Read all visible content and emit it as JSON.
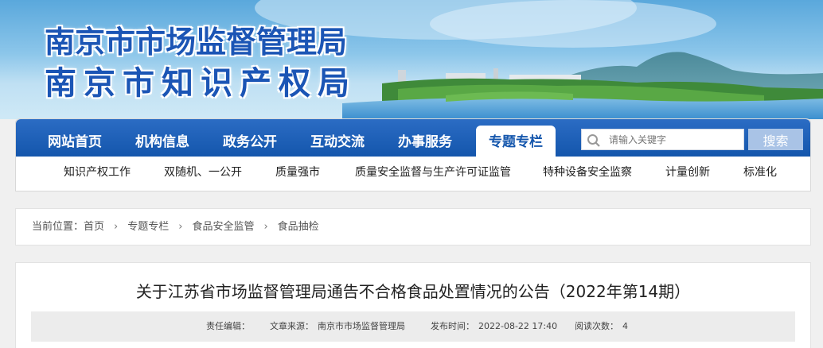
{
  "site": {
    "title_line1": "南京市市场监督管理局",
    "title_line2": "南京市知识产权局"
  },
  "nav": {
    "main_items": [
      "网站首页",
      "机构信息",
      "政务公开",
      "互动交流",
      "办事服务",
      "专题专栏"
    ],
    "active_item": "专题专栏",
    "sub_items": [
      "知识产权工作",
      "双随机、一公开",
      "质量强市",
      "质量安全监督与生产许可证监管",
      "特种设备安全监察",
      "计量创新",
      "标准化"
    ]
  },
  "search": {
    "placeholder": "请输入关键字",
    "button_label": "搜索",
    "icon": "search-icon"
  },
  "breadcrumb": {
    "prefix": "当前位置：",
    "items": [
      "首页",
      "专题专栏",
      "食品安全监管",
      "食品抽检"
    ]
  },
  "article": {
    "title": "关于江苏省市场监督管理局通告不合格食品处置情况的公告（2022年第14期）",
    "editor_label": "责任编辑：",
    "source_label": "文章来源：",
    "source_value": "南京市市场监督管理局",
    "date_label": "发布时间：",
    "date_value": "2022-08-22 17:40",
    "views_label": "阅读次数：",
    "views_value": "4"
  },
  "colors": {
    "nav_blue": "#1456ac",
    "title_blue": "#1b55b5",
    "search_button": "#a9c3e6"
  }
}
